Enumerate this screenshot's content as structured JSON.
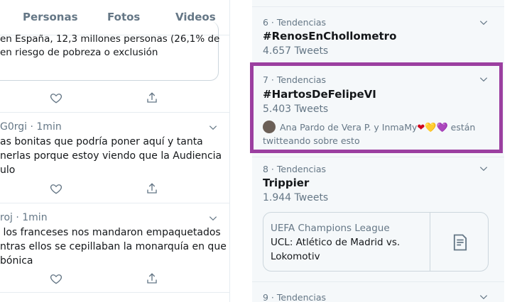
{
  "timeline": {
    "tabs": [
      {
        "label": "Personas"
      },
      {
        "label": "Fotos"
      },
      {
        "label": "Videos"
      }
    ],
    "quoted_text": "en España, 12,3 millones personas (26,1% de\nen riesgo de pobreza o exclusión",
    "tweets": [
      {
        "head": "G0rgi · 1min",
        "body": "as bonitas que podría poner aquí y tanta\nnerlas porque estoy viendo que la Audiencia\nulo"
      },
      {
        "head": "roj · 1min",
        "body": " los franceses nos mandaron empaquetados\nntras ellos se cepillaban la monarquía en que\nbónica"
      }
    ]
  },
  "trends": [
    {
      "meta": "6 · Tendencias",
      "name": "#RenosEnChollometro",
      "count": "4.657 Tweets"
    },
    {
      "meta": "7 · Tendencias",
      "name": "#HartosDeFelipeVI",
      "count": "5.403 Tweets",
      "who_text": "Ana Pardo de Vera P. y InmaMy",
      "who_suffix": " están twitteando sobre esto",
      "hearts": [
        "❤",
        "💛",
        "💜"
      ]
    },
    {
      "meta": "8 · Tendencias",
      "name": "Trippier",
      "count": "1.944 Tweets"
    },
    {
      "meta": "9 · Tendencias",
      "name": "",
      "count": ""
    }
  ],
  "event": {
    "subtitle": "UEFA Champions League",
    "title": "UCL: Atlético de Madrid vs. Lokomotiv"
  },
  "colors": {
    "highlight": "#9b3fa0",
    "muted": "#657786",
    "border": "#e6ecf0",
    "panel": "#f5f8fa"
  },
  "icons": [
    "heart-icon",
    "share-icon",
    "chevron-down-icon",
    "document-icon",
    "avatar"
  ]
}
